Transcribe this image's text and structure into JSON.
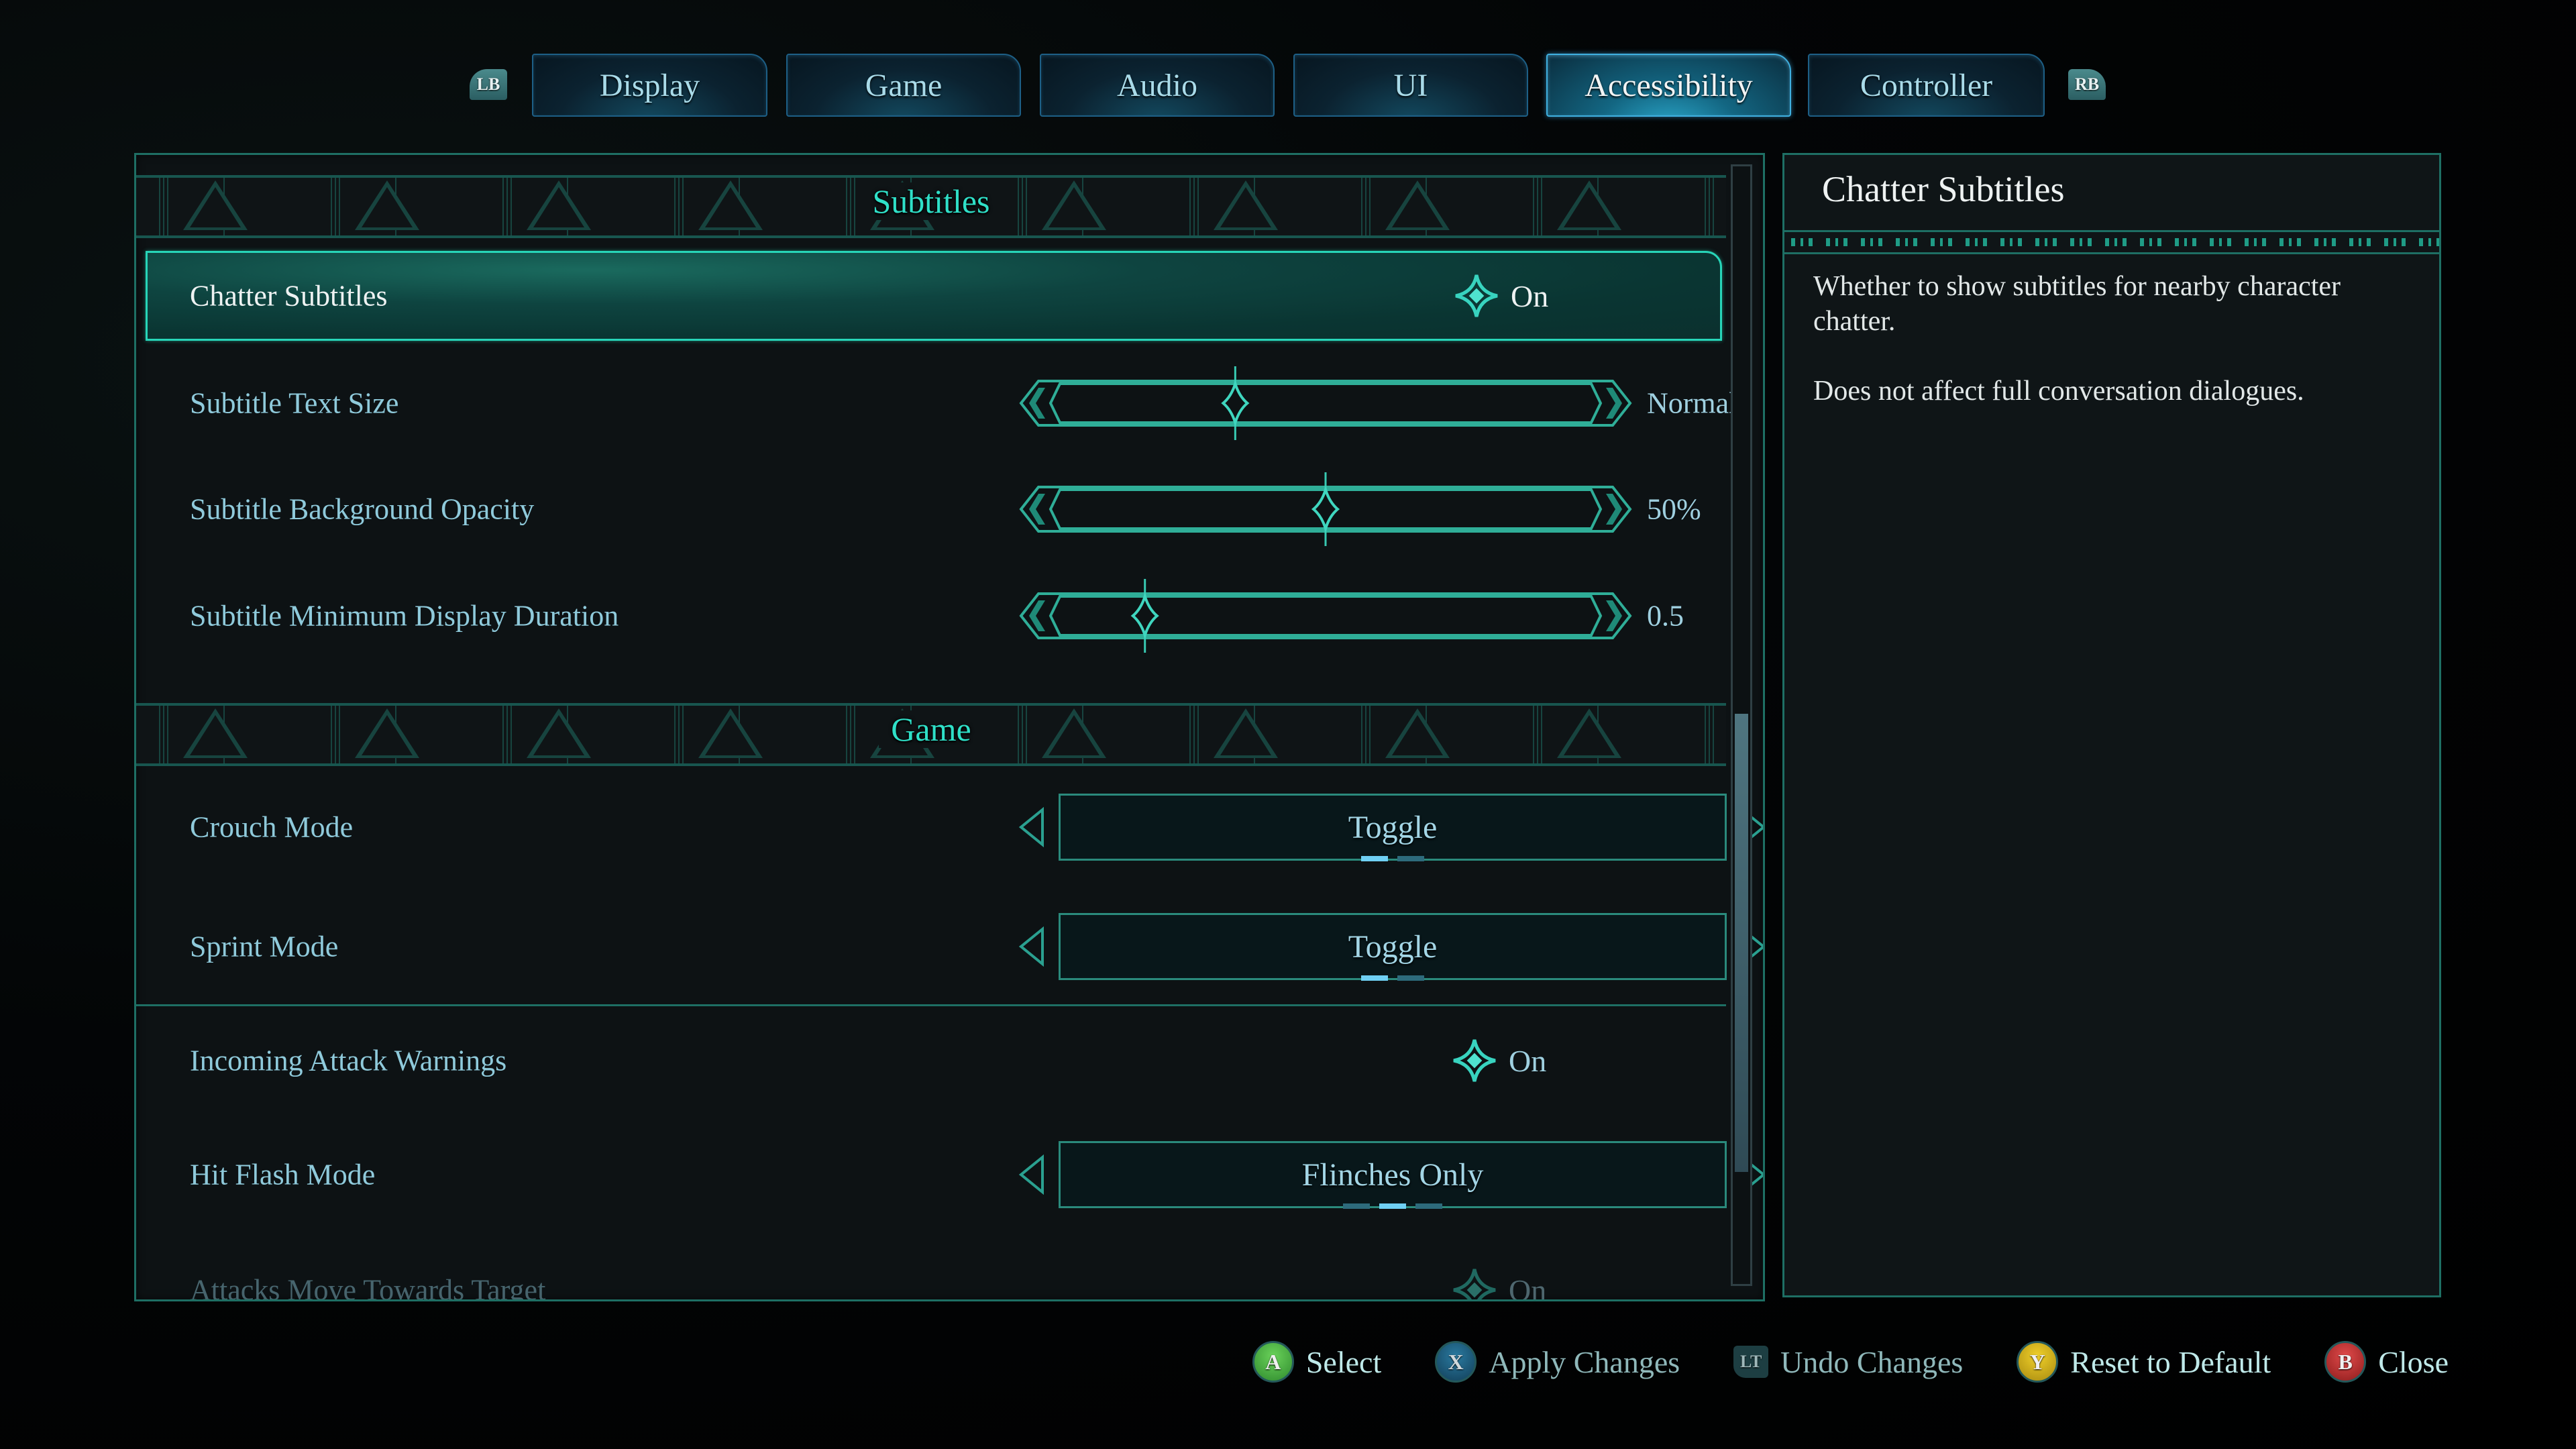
{
  "tabs": {
    "left_bumper": "LB",
    "right_bumper": "RB",
    "items": [
      {
        "label": "Display",
        "active": false
      },
      {
        "label": "Game",
        "active": false
      },
      {
        "label": "Audio",
        "active": false
      },
      {
        "label": "UI",
        "active": false
      },
      {
        "label": "Accessibility",
        "active": true
      },
      {
        "label": "Controller",
        "active": false
      }
    ]
  },
  "settings": {
    "sections": [
      {
        "title": "Subtitles"
      },
      {
        "title": "Game"
      }
    ],
    "rows": [
      {
        "label": "Chatter Subtitles",
        "type": "toggle",
        "value": "On",
        "selected": true
      },
      {
        "label": "Subtitle Text Size",
        "type": "slider",
        "value": "Normal",
        "position_fraction": 0.33
      },
      {
        "label": "Subtitle Background Opacity",
        "type": "slider",
        "value": "50%",
        "position_fraction": 0.5
      },
      {
        "label": "Subtitle Minimum Display Duration",
        "type": "slider",
        "value": "0.5",
        "position_fraction": 0.16
      },
      {
        "label": "Crouch Mode",
        "type": "selector",
        "value": "Toggle",
        "option_count": 2,
        "option_index": 0
      },
      {
        "label": "Sprint Mode",
        "type": "selector",
        "value": "Toggle",
        "option_count": 2,
        "option_index": 0
      },
      {
        "label": "Incoming Attack Warnings",
        "type": "toggle",
        "value": "On"
      },
      {
        "label": "Hit Flash Mode",
        "type": "selector",
        "value": "Flinches Only",
        "option_count": 3,
        "option_index": 1
      },
      {
        "label": "Attacks Move Towards Target",
        "type": "toggle",
        "value": "On"
      }
    ],
    "scrollbar": {
      "thumb_start_fraction": 0.49,
      "thumb_end_fraction": 0.9
    }
  },
  "description": {
    "title": "Chatter Subtitles",
    "paragraphs": [
      "Whether to show subtitles for nearby character chatter.",
      "Does not affect full conversation dialogues."
    ]
  },
  "footer": {
    "hints": [
      {
        "button": "A",
        "label": "Select"
      },
      {
        "button": "X",
        "label": "Apply Changes"
      },
      {
        "button": "LT",
        "label": "Undo Changes"
      },
      {
        "button": "Y",
        "label": "Reset to Default"
      },
      {
        "button": "B",
        "label": "Close"
      }
    ]
  },
  "colors": {
    "accent_teal": "#27d5b8",
    "section_title": "#2fe0c8",
    "label_text": "#8fcadb",
    "tab_active_border": "#3fb0e0"
  }
}
